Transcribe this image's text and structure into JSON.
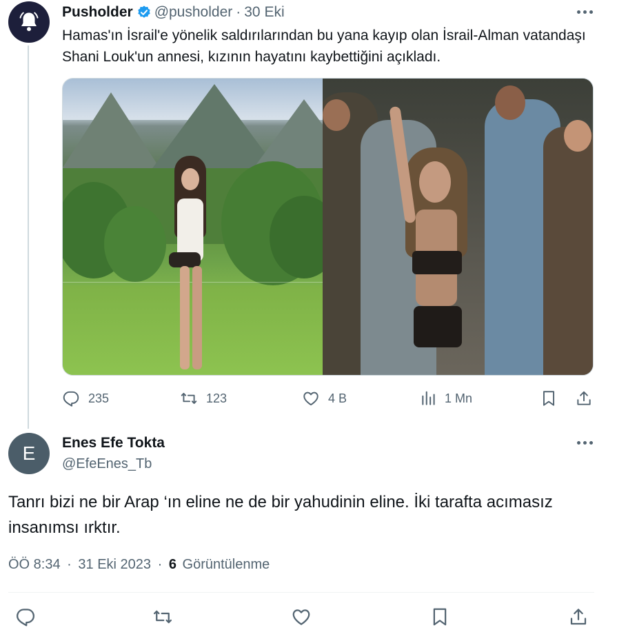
{
  "parent_tweet": {
    "author_name": "Pusholder",
    "handle": "@pusholder",
    "separator": "·",
    "date": "30 Eki",
    "text": "Hamas'ın İsrail'e yönelik saldırılarından bu yana kayıp olan İsrail-Alman vatandaşı Shani Louk'un annesi, kızının hayatını kaybettiğini açıkladı.",
    "stats": {
      "replies": "235",
      "retweets": "123",
      "likes": "4 B",
      "views": "1 Mn"
    },
    "media_count": 2
  },
  "reply_tweet": {
    "avatar_letter": "E",
    "author_name": "Enes Efe Tokta",
    "handle": "@EfeEnes_Tb",
    "text": "Tanrı bizi ne bir Arap ‘ın eline ne de bir yahudinin eline. İki tarafta acımasız insanımsı ırktır.",
    "time": "ÖÖ 8:34",
    "separator": "·",
    "date": "31 Eki 2023",
    "views_count": "6",
    "views_label": "Görüntülenme"
  },
  "colors": {
    "text_primary": "#0f1419",
    "text_secondary": "#536471",
    "verified_blue": "#1d9bf0",
    "avatar_bg": "#1d1f3b",
    "reply_avatar_bg": "#4b5d69"
  },
  "icons": [
    "bell-icon",
    "verified-badge-icon",
    "more-icon",
    "reply-icon",
    "retweet-icon",
    "like-icon",
    "views-icon",
    "bookmark-icon",
    "share-icon"
  ]
}
